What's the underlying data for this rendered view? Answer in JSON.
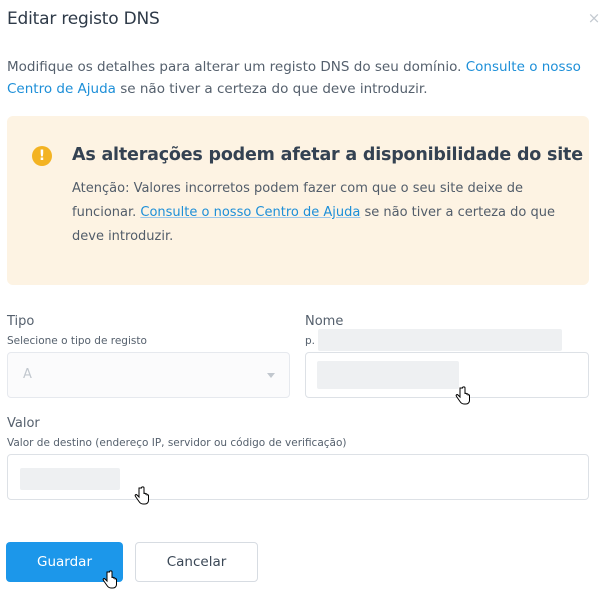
{
  "dialog": {
    "title": "Editar registo DNS",
    "close_label": "×",
    "intro": {
      "text": "Modifique os detalhes para alterar um registo DNS do seu domínio. ",
      "link": "Consulte o nosso Centro de Ajuda",
      "suffix": " se não tiver a certeza do que deve introduzir."
    },
    "warning": {
      "icon": "exclamation-icon",
      "icon_glyph": "!",
      "title": "As alterações podem afetar a disponibilidade do site",
      "body_prefix": "Atenção: Valores incorretos podem fazer com que o seu site deixe de funcionar. ",
      "body_link": "Consulte o nosso Centro de Ajuda",
      "body_suffix": " se não tiver a certeza do que deve introduzir."
    },
    "fields": {
      "tipo": {
        "label": "Tipo",
        "help": "Selecione o tipo de registo",
        "value": "A"
      },
      "nome": {
        "label": "Nome",
        "help": "p."
      },
      "valor": {
        "label": "Valor",
        "help": "Valor de destino (endereço IP, servidor ou código de verificação)"
      }
    },
    "buttons": {
      "save": "Guardar",
      "cancel": "Cancelar"
    }
  },
  "colors": {
    "accent": "#1c97ea",
    "link": "#1d8fd8",
    "warning_bg": "#fdf3e3",
    "warning_icon": "#f3b323"
  }
}
